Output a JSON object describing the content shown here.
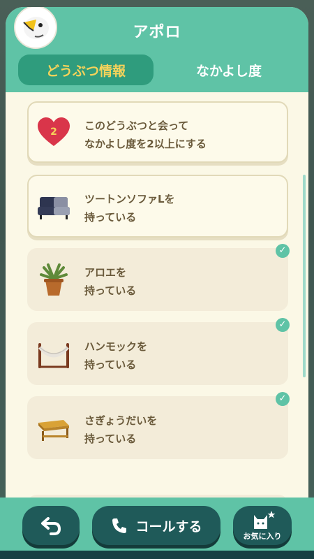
{
  "header": {
    "title": "アポロ",
    "avatar_icon": "bald-eagle-villager-avatar"
  },
  "tabs": [
    {
      "label": "どうぶつ情報",
      "active": true
    },
    {
      "label": "なかよし度",
      "active": false
    }
  ],
  "tasks": [
    {
      "line1": "このどうぶつと会って",
      "line2": "なかよし度を2以上にする",
      "icon": "heart-icon",
      "icon_number": "2",
      "completed": false
    },
    {
      "line1": "ツートンソファLを",
      "line2": "持っている",
      "icon": "sofa-icon",
      "completed": false
    },
    {
      "line1": "アロエを",
      "line2": "持っている",
      "icon": "potted-aloe-icon",
      "completed": true
    },
    {
      "line1": "ハンモックを",
      "line2": "持っている",
      "icon": "hammock-icon",
      "completed": true
    },
    {
      "line1": "さぎょうだいを",
      "line2": "持っている",
      "icon": "workbench-icon",
      "completed": true
    }
  ],
  "footer": {
    "back_icon": "back-arrow-icon",
    "call_label": "コールする",
    "call_icon": "phone-icon",
    "favorite_label": "お気に入り",
    "favorite_icon": "cat-star-icon"
  },
  "colors": {
    "accent": "#5fc3a6",
    "tab_active_bg": "#2f9c7d",
    "tab_active_text": "#f6d35a",
    "button_bg": "#1f5a59",
    "card_text": "#6a5a3b",
    "heart": "#d9354a"
  }
}
